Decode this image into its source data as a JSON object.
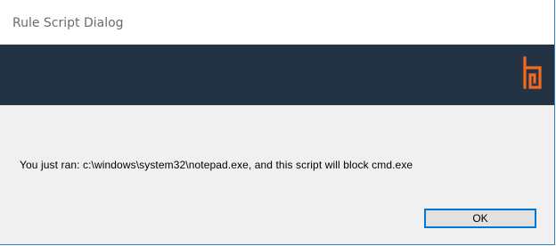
{
  "window": {
    "title": "Rule Script Dialog"
  },
  "banner": {
    "background_color": "#243344",
    "logo_icon": "brand-logo-icon",
    "logo_color": "#f26a21"
  },
  "dialog": {
    "message": "You just ran: c:\\windows\\system32\\notepad.exe, and this script will block cmd.exe",
    "ok_label": "OK"
  },
  "colors": {
    "focus_border": "#0078d7",
    "body_background": "#f0f0f0"
  }
}
